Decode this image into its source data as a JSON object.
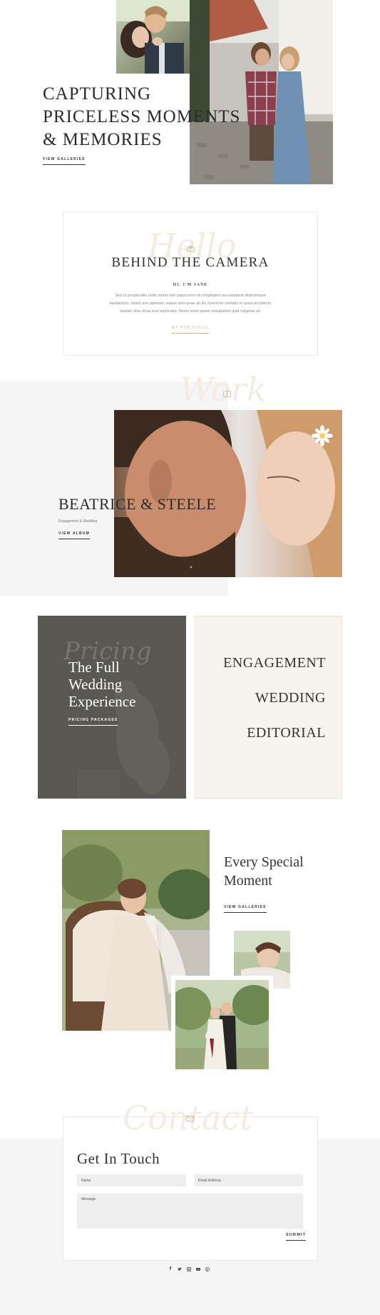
{
  "hero": {
    "title_lines": [
      "CAPTURING",
      "PRICELESS MOMENTS",
      "& MEMORIES"
    ],
    "link": "VIEW GALLERIES"
  },
  "about": {
    "script_word": "Hello",
    "title": "BEHIND THE CAMERA",
    "subtitle": "HI, I'M JANE",
    "body_lines": [
      "Sed ut perspiciatis unde omnis iste natus error sit voluptatem accusantium doloremque",
      "laudantium, totam rem aperiam, eaque ipsa quae ab illo inventore veritatis et quasi architecto",
      "beatae vitae dicta sunt explicabo. Nemo enim ipsam voluptatem quia voluptas sit."
    ],
    "link": "MY PORTFOLIO"
  },
  "work": {
    "script_word": "Work",
    "title": "BEATRICE & STEELE",
    "subtitle": "Engagement & Wedding",
    "link": "VIEW ALBUM"
  },
  "pricing": {
    "script_word": "Pricing",
    "title_lines": [
      "The Full",
      "Wedding",
      "Experience"
    ],
    "link": "PRICING PACKAGES",
    "offerings": [
      "ENGAGEMENT",
      "WEDDING",
      "EDITORIAL"
    ]
  },
  "gallery": {
    "title_lines": [
      "Every Special",
      "Moment"
    ],
    "link": "VIEW GALLERIES"
  },
  "contact": {
    "script_word": "Contact",
    "title": "Get In Touch",
    "name_placeholder": "Name",
    "email_placeholder": "Email Address",
    "message_placeholder": "Message",
    "submit": "SUBMIT"
  },
  "social_icons": [
    "facebook-icon",
    "twitter-icon",
    "instagram-icon",
    "youtube-icon",
    "pinterest-icon"
  ],
  "colors": {
    "accent_gold": "#c9b48b",
    "light_gray_bg": "#f5f5f5",
    "cream": "#f7f4ef",
    "dark_panel": "#55544e"
  }
}
